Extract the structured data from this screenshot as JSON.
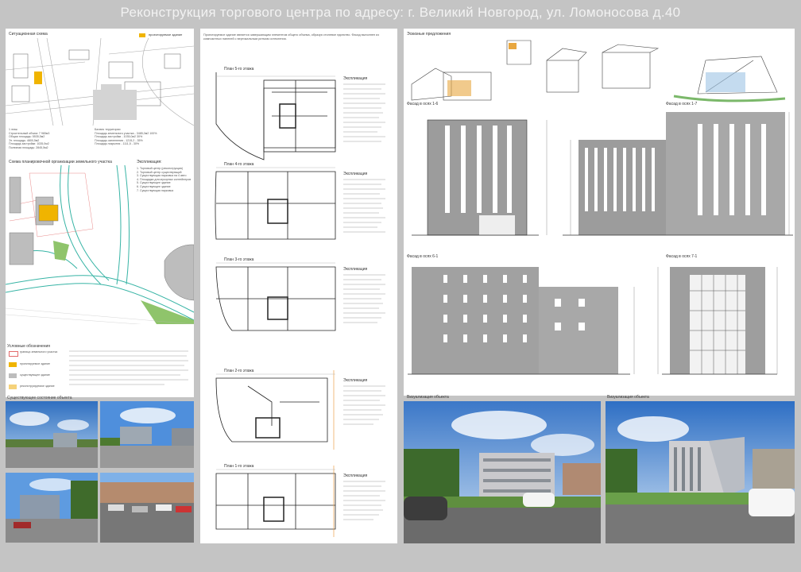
{
  "title": "Реконструкция торгового центра по адресу:   г. Великий Новгород, ул. Ломоносова д.40",
  "left": {
    "situation_label": "Ситуационная схема",
    "legend_yellow": "проектируемое здание",
    "zoning_label": "Схема планировочной организации земельного участка",
    "explication_label": "Экспликация:",
    "explication_items": [
      "1. Торговый центр (реконструкция)",
      "2. Торговый центр существующий",
      "3. Существующая парковка на 4 авто",
      "4. Площадка для мусорных контейнеров",
      "5. Существующее здание",
      "6. Существующее здание",
      "7. Существующая парковка"
    ],
    "balance_label": "Баланс территории",
    "balance_items": [
      "Площадь земельного участка - 3485,0м2 100%",
      "Площадь застройки - 1035,0м2 30%",
      "Площадь озеленения - 1215,2 - 35%",
      "Площадь покрытия - 1111,5 - 30%"
    ],
    "red_items": [
      "1 этаж",
      "Строительный объем: 7 965м3",
      "Общая площадь: 5535,5м2",
      "Эт. площадь: 4800,5м2",
      "Площадь застройки: 1035,0м2",
      "Полезная площадь: 2845,5м2"
    ],
    "legend_label": "Условные обозначения",
    "legend_items": [
      "граница земельного участка",
      "проектируемое здание",
      "существующее здание",
      "реконструируемое здание"
    ],
    "photos_label": "Существующее состояние объекта"
  },
  "middle": {
    "intro_text": "Проектируемое здание является завершающим элементом общего объема, образуя стилевое единство. Фасад выполнен из композитных панелей с вертикальным ритмом остекления.",
    "plans": [
      {
        "title": "План 5-го этажа",
        "explication": "Экспликация"
      },
      {
        "title": "План 4-го этажа",
        "explication": "Экспликация"
      },
      {
        "title": "План 3-го этажа",
        "explication": "Экспликация"
      },
      {
        "title": "План 2-го этажа",
        "explication": "Экспликация"
      },
      {
        "title": "План 1-го этажа",
        "explication": "Экспликация"
      }
    ]
  },
  "right": {
    "sketch_label": "Эскизные предложения",
    "facade1": "Фасад в осях 1-6",
    "facade2": "Фасад в осях 1-7",
    "facade3": "Фасад в осях 6-1",
    "facade4": "Фасад в осях 7-1",
    "viz1": "Визуализация объекта",
    "viz2": "Визуализация объекта"
  }
}
